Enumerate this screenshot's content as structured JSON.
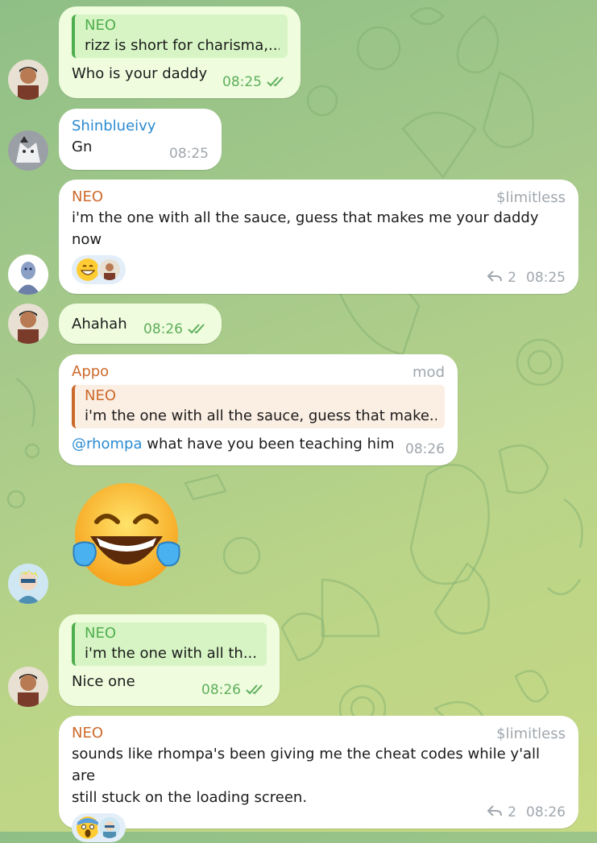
{
  "colors": {
    "own_bubble": "#effdde",
    "other_bubble": "#ffffff",
    "name_neo": "#cc6a2c",
    "name_shin": "#2a8bd0",
    "quote_own_green": "#4fae4e",
    "time_green": "#5fae5d",
    "time_gray": "#a0a7ae"
  },
  "messages": [
    {
      "id": "m1",
      "own": true,
      "quote_name": "NEO",
      "quote_text": "rizz is short for charisma,...",
      "text": "Who is your daddy",
      "time": "08:25"
    },
    {
      "id": "m2",
      "own": false,
      "sender": "Shinblueivy",
      "text": "Gn",
      "time": "08:25"
    },
    {
      "id": "m3",
      "own": false,
      "sender": "NEO",
      "tag": "$limitless",
      "text_line1": "i'm the one with all the sauce, guess that makes me your daddy",
      "text_line2": "now",
      "reply_count": "2",
      "time": "08:25"
    },
    {
      "id": "m4",
      "own": true,
      "text": "Ahahah",
      "time": "08:26"
    },
    {
      "id": "m5",
      "own": false,
      "sender": "Appo",
      "tag": "mod",
      "quote_name": "NEO",
      "quote_text": "i'm the one with all the sauce, guess that make...",
      "mention": "@rhompa",
      "text": " what have you been teaching him",
      "time": "08:26"
    },
    {
      "id": "m6",
      "own": false,
      "sticker": "laughing-tears-emoji"
    },
    {
      "id": "m7",
      "own": true,
      "quote_name": "NEO",
      "quote_text": "i'm the one with all th...",
      "text": "Nice one",
      "time": "08:26"
    },
    {
      "id": "m8",
      "own": false,
      "sender": "NEO",
      "tag": "$limitless",
      "text_line1": "sounds like rhompa's been giving me the cheat codes while y'all are",
      "text_line2": "still stuck on the loading screen.",
      "reply_count": "2",
      "time": "08:26"
    }
  ]
}
